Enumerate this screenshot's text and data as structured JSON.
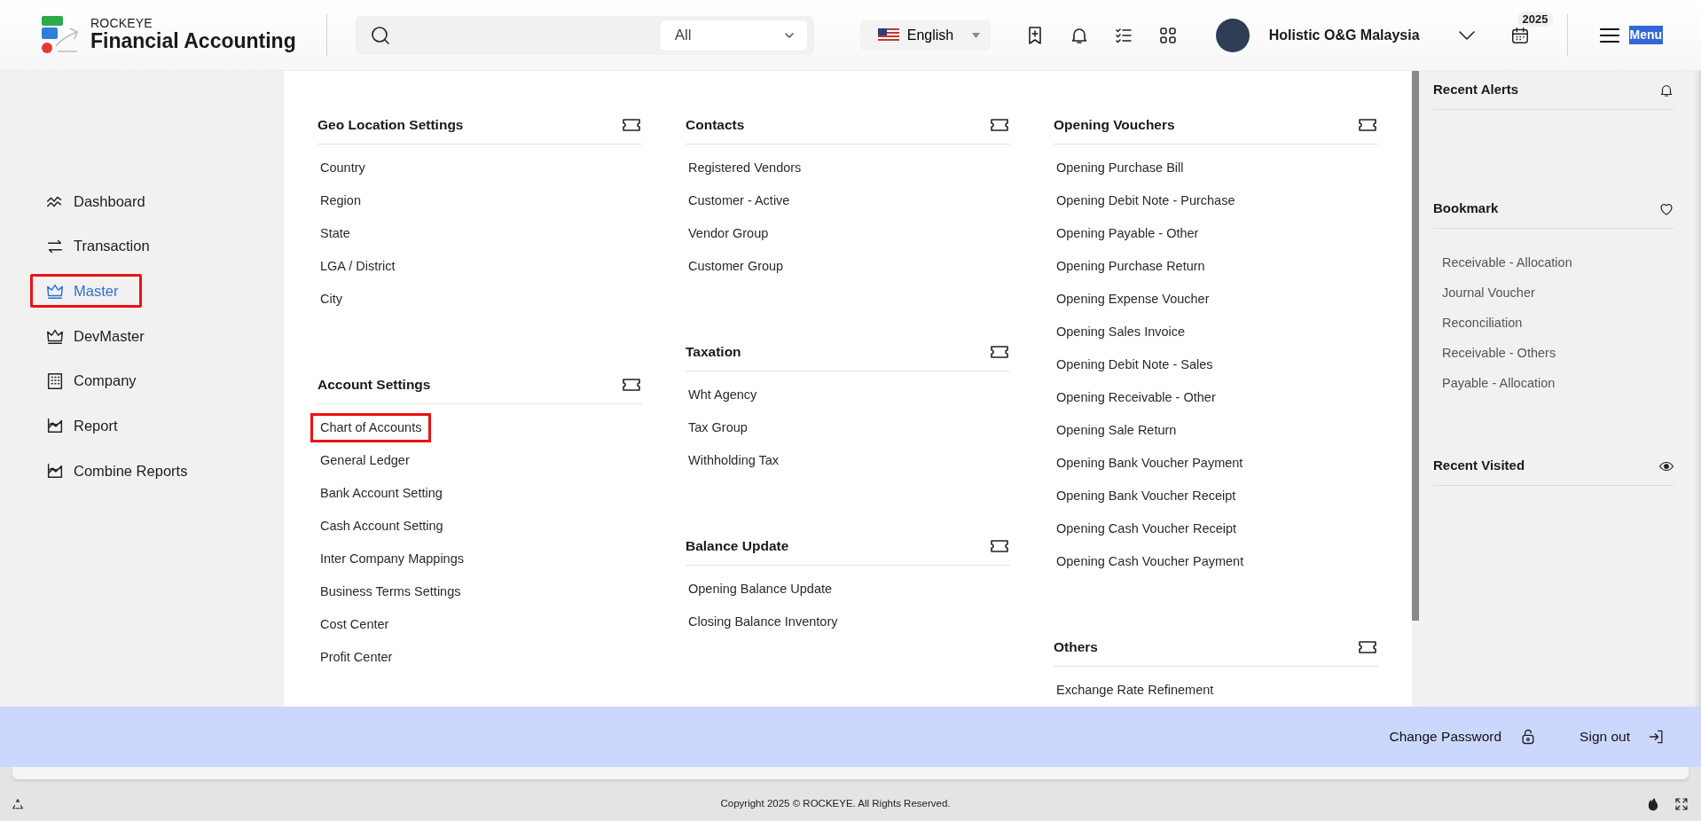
{
  "header": {
    "brand": {
      "overline": "ROCKEYE",
      "title": "Financial Accounting"
    },
    "search": {
      "scope": "All"
    },
    "language": "English",
    "company": "Holistic O&G Malaysia",
    "year_badge": "2025",
    "menu_button": {
      "label": "Menu",
      "text_selected": true
    }
  },
  "sidebar": {
    "items": [
      {
        "label": "Dashboard",
        "selected": false,
        "highlighted": false
      },
      {
        "label": "Transaction",
        "selected": false,
        "highlighted": false
      },
      {
        "label": "Master",
        "selected": true,
        "highlighted": true
      },
      {
        "label": "DevMaster",
        "selected": false,
        "highlighted": false
      },
      {
        "label": "Company",
        "selected": false,
        "highlighted": false
      },
      {
        "label": "Report",
        "selected": false,
        "highlighted": false
      },
      {
        "label": "Combine Reports",
        "selected": false,
        "highlighted": false
      }
    ]
  },
  "menu": {
    "columns": [
      {
        "sections": [
          {
            "title": "Geo Location Settings",
            "items": [
              {
                "label": "Country",
                "highlighted": false
              },
              {
                "label": "Region",
                "highlighted": false
              },
              {
                "label": "State",
                "highlighted": false
              },
              {
                "label": "LGA / District",
                "highlighted": false
              },
              {
                "label": "City",
                "highlighted": false
              }
            ]
          },
          {
            "title": "Account Settings",
            "items": [
              {
                "label": "Chart of Accounts",
                "highlighted": true
              },
              {
                "label": "General Ledger",
                "highlighted": false
              },
              {
                "label": "Bank Account Setting",
                "highlighted": false
              },
              {
                "label": "Cash Account Setting",
                "highlighted": false
              },
              {
                "label": "Inter Company Mappings",
                "highlighted": false
              },
              {
                "label": "Business Terms Settings",
                "highlighted": false
              },
              {
                "label": "Cost Center",
                "highlighted": false
              },
              {
                "label": "Profit Center",
                "highlighted": false
              }
            ]
          }
        ]
      },
      {
        "sections": [
          {
            "title": "Contacts",
            "items": [
              {
                "label": "Registered Vendors",
                "highlighted": false
              },
              {
                "label": "Customer - Active",
                "highlighted": false
              },
              {
                "label": "Vendor Group",
                "highlighted": false
              },
              {
                "label": "Customer Group",
                "highlighted": false
              }
            ]
          },
          {
            "title": "Taxation",
            "items": [
              {
                "label": "Wht Agency",
                "highlighted": false
              },
              {
                "label": "Tax Group",
                "highlighted": false
              },
              {
                "label": "Withholding Tax",
                "highlighted": false
              }
            ]
          },
          {
            "title": "Balance Update",
            "items": [
              {
                "label": "Opening Balance Update",
                "highlighted": false
              },
              {
                "label": "Closing Balance Inventory",
                "highlighted": false
              }
            ]
          }
        ]
      },
      {
        "sections": [
          {
            "title": "Opening Vouchers",
            "items": [
              {
                "label": "Opening Purchase Bill",
                "highlighted": false
              },
              {
                "label": "Opening Debit Note - Purchase",
                "highlighted": false
              },
              {
                "label": "Opening Payable - Other",
                "highlighted": false
              },
              {
                "label": "Opening Purchase Return",
                "highlighted": false
              },
              {
                "label": "Opening Expense Voucher",
                "highlighted": false
              },
              {
                "label": "Opening Sales Invoice",
                "highlighted": false
              },
              {
                "label": "Opening Debit Note - Sales",
                "highlighted": false
              },
              {
                "label": "Opening Receivable - Other",
                "highlighted": false
              },
              {
                "label": "Opening Sale Return",
                "highlighted": false
              },
              {
                "label": "Opening Bank Voucher Payment",
                "highlighted": false
              },
              {
                "label": "Opening Bank Voucher Receipt",
                "highlighted": false
              },
              {
                "label": "Opening Cash Voucher Receipt",
                "highlighted": false
              },
              {
                "label": "Opening Cash Voucher Payment",
                "highlighted": false
              }
            ]
          },
          {
            "title": "Others",
            "items": [
              {
                "label": "Exchange Rate Refinement",
                "highlighted": false
              }
            ]
          }
        ]
      }
    ]
  },
  "right_panel": {
    "sections": [
      {
        "title": "Recent Alerts"
      },
      {
        "title": "Bookmark",
        "items": [
          "Receivable - Allocation",
          "Journal Voucher",
          "Reconciliation",
          "Receivable - Others",
          "Payable - Allocation"
        ]
      },
      {
        "title": "Recent Visited"
      }
    ]
  },
  "account_bar": {
    "links": [
      "Change Password",
      "Sign out"
    ]
  },
  "footer": {
    "copyright": "Copyright 2025 © ROCKEYE. All Rights Reserved."
  }
}
